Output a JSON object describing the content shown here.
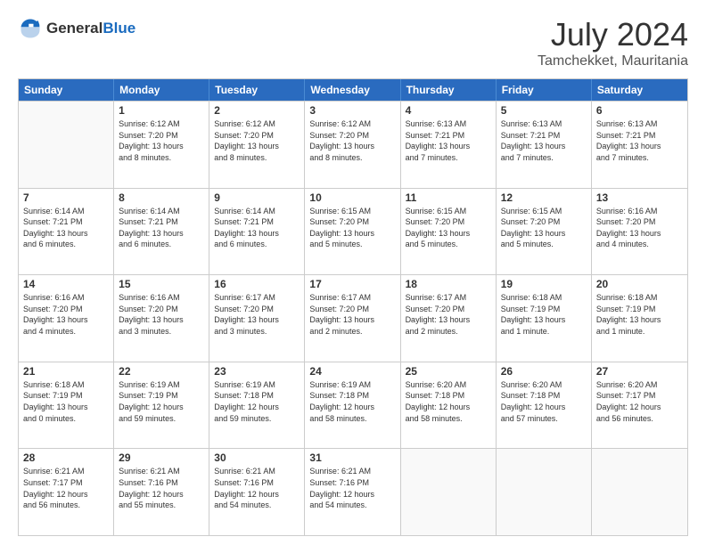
{
  "header": {
    "logo": {
      "general": "General",
      "blue": "Blue"
    },
    "title": "July 2024",
    "location": "Tamchekket, Mauritania"
  },
  "days_of_week": [
    "Sunday",
    "Monday",
    "Tuesday",
    "Wednesday",
    "Thursday",
    "Friday",
    "Saturday"
  ],
  "weeks": [
    [
      {
        "day": "",
        "info": ""
      },
      {
        "day": "1",
        "info": "Sunrise: 6:12 AM\nSunset: 7:20 PM\nDaylight: 13 hours\nand 8 minutes."
      },
      {
        "day": "2",
        "info": "Sunrise: 6:12 AM\nSunset: 7:20 PM\nDaylight: 13 hours\nand 8 minutes."
      },
      {
        "day": "3",
        "info": "Sunrise: 6:12 AM\nSunset: 7:20 PM\nDaylight: 13 hours\nand 8 minutes."
      },
      {
        "day": "4",
        "info": "Sunrise: 6:13 AM\nSunset: 7:21 PM\nDaylight: 13 hours\nand 7 minutes."
      },
      {
        "day": "5",
        "info": "Sunrise: 6:13 AM\nSunset: 7:21 PM\nDaylight: 13 hours\nand 7 minutes."
      },
      {
        "day": "6",
        "info": "Sunrise: 6:13 AM\nSunset: 7:21 PM\nDaylight: 13 hours\nand 7 minutes."
      }
    ],
    [
      {
        "day": "7",
        "info": "Sunrise: 6:14 AM\nSunset: 7:21 PM\nDaylight: 13 hours\nand 6 minutes."
      },
      {
        "day": "8",
        "info": "Sunrise: 6:14 AM\nSunset: 7:21 PM\nDaylight: 13 hours\nand 6 minutes."
      },
      {
        "day": "9",
        "info": "Sunrise: 6:14 AM\nSunset: 7:21 PM\nDaylight: 13 hours\nand 6 minutes."
      },
      {
        "day": "10",
        "info": "Sunrise: 6:15 AM\nSunset: 7:20 PM\nDaylight: 13 hours\nand 5 minutes."
      },
      {
        "day": "11",
        "info": "Sunrise: 6:15 AM\nSunset: 7:20 PM\nDaylight: 13 hours\nand 5 minutes."
      },
      {
        "day": "12",
        "info": "Sunrise: 6:15 AM\nSunset: 7:20 PM\nDaylight: 13 hours\nand 5 minutes."
      },
      {
        "day": "13",
        "info": "Sunrise: 6:16 AM\nSunset: 7:20 PM\nDaylight: 13 hours\nand 4 minutes."
      }
    ],
    [
      {
        "day": "14",
        "info": "Sunrise: 6:16 AM\nSunset: 7:20 PM\nDaylight: 13 hours\nand 4 minutes."
      },
      {
        "day": "15",
        "info": "Sunrise: 6:16 AM\nSunset: 7:20 PM\nDaylight: 13 hours\nand 3 minutes."
      },
      {
        "day": "16",
        "info": "Sunrise: 6:17 AM\nSunset: 7:20 PM\nDaylight: 13 hours\nand 3 minutes."
      },
      {
        "day": "17",
        "info": "Sunrise: 6:17 AM\nSunset: 7:20 PM\nDaylight: 13 hours\nand 2 minutes."
      },
      {
        "day": "18",
        "info": "Sunrise: 6:17 AM\nSunset: 7:20 PM\nDaylight: 13 hours\nand 2 minutes."
      },
      {
        "day": "19",
        "info": "Sunrise: 6:18 AM\nSunset: 7:19 PM\nDaylight: 13 hours\nand 1 minute."
      },
      {
        "day": "20",
        "info": "Sunrise: 6:18 AM\nSunset: 7:19 PM\nDaylight: 13 hours\nand 1 minute."
      }
    ],
    [
      {
        "day": "21",
        "info": "Sunrise: 6:18 AM\nSunset: 7:19 PM\nDaylight: 13 hours\nand 0 minutes."
      },
      {
        "day": "22",
        "info": "Sunrise: 6:19 AM\nSunset: 7:19 PM\nDaylight: 12 hours\nand 59 minutes."
      },
      {
        "day": "23",
        "info": "Sunrise: 6:19 AM\nSunset: 7:18 PM\nDaylight: 12 hours\nand 59 minutes."
      },
      {
        "day": "24",
        "info": "Sunrise: 6:19 AM\nSunset: 7:18 PM\nDaylight: 12 hours\nand 58 minutes."
      },
      {
        "day": "25",
        "info": "Sunrise: 6:20 AM\nSunset: 7:18 PM\nDaylight: 12 hours\nand 58 minutes."
      },
      {
        "day": "26",
        "info": "Sunrise: 6:20 AM\nSunset: 7:18 PM\nDaylight: 12 hours\nand 57 minutes."
      },
      {
        "day": "27",
        "info": "Sunrise: 6:20 AM\nSunset: 7:17 PM\nDaylight: 12 hours\nand 56 minutes."
      }
    ],
    [
      {
        "day": "28",
        "info": "Sunrise: 6:21 AM\nSunset: 7:17 PM\nDaylight: 12 hours\nand 56 minutes."
      },
      {
        "day": "29",
        "info": "Sunrise: 6:21 AM\nSunset: 7:16 PM\nDaylight: 12 hours\nand 55 minutes."
      },
      {
        "day": "30",
        "info": "Sunrise: 6:21 AM\nSunset: 7:16 PM\nDaylight: 12 hours\nand 54 minutes."
      },
      {
        "day": "31",
        "info": "Sunrise: 6:21 AM\nSunset: 7:16 PM\nDaylight: 12 hours\nand 54 minutes."
      },
      {
        "day": "",
        "info": ""
      },
      {
        "day": "",
        "info": ""
      },
      {
        "day": "",
        "info": ""
      }
    ]
  ]
}
